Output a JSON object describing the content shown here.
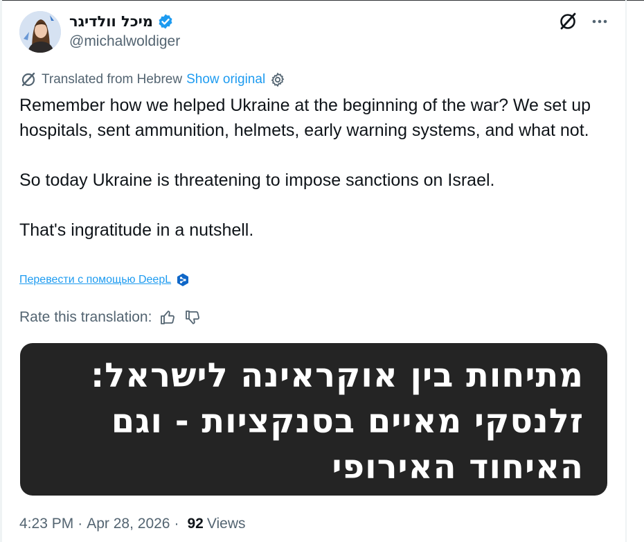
{
  "author": {
    "display_name": "מיכל וולדיגר",
    "handle": "@michalwoldiger",
    "verified": true
  },
  "icons": {
    "avatar": "avatar-photo",
    "verified": "verified-badge-icon",
    "grok": "grok-icon",
    "more": "more-icon",
    "translated": "translate-icon",
    "gear": "gear-icon",
    "deepl": "deepl-icon",
    "thumbs_up": "thumbs-up-icon",
    "thumbs_down": "thumbs-down-icon"
  },
  "translation": {
    "notice": "Translated from Hebrew",
    "show_original": "Show original",
    "deepl_link": "Перевести с помощью DeepL",
    "rate_label": "Rate this translation:"
  },
  "tweet": {
    "paragraphs": [
      "Remember how we helped Ukraine at the beginning of the war? We set up hospitals, sent ammunition, helmets, early warning systems, and what not.",
      "So today Ukraine is threatening to impose sanctions on Israel.",
      "That's ingratitude in a nutshell."
    ]
  },
  "media": {
    "lines": [
      "מתיחות בין אוקראינה לישראל:",
      "זלנסקי מאיים בסנקציות - וגם",
      "האיחוד האירופי"
    ]
  },
  "meta": {
    "time": "4:23 PM",
    "date": "Apr 28, 2026",
    "separator": "·",
    "views_count": "92",
    "views_label": "Views"
  },
  "colors": {
    "text": "#0f1419",
    "secondary": "#536471",
    "link": "#1d9bf0",
    "media_bg": "#242424",
    "media_text": "#ffffff"
  }
}
